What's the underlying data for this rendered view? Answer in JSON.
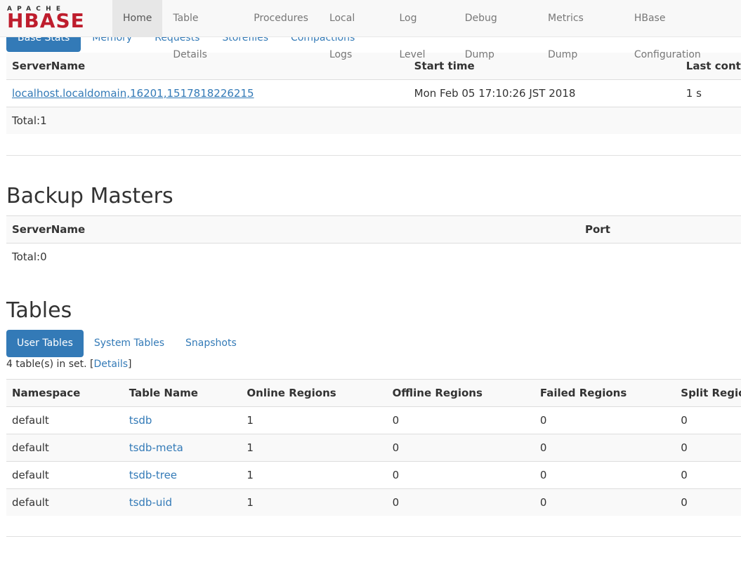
{
  "navbar": {
    "logo_top": "APACHE",
    "logo_main": "HBASE",
    "items": [
      {
        "label": "Home",
        "active": true
      },
      {
        "label": "Table Details"
      },
      {
        "label": "Procedures"
      },
      {
        "label": "Local Logs"
      },
      {
        "label": "Log Level"
      },
      {
        "label": "Debug Dump"
      },
      {
        "label": "Metrics Dump"
      },
      {
        "label": "HBase Configuration"
      }
    ]
  },
  "region_servers": {
    "tabs": [
      "Base Stats",
      "Memory",
      "Requests",
      "Storefiles",
      "Compactions"
    ],
    "columns": [
      "ServerName",
      "Start time",
      "Last contact"
    ],
    "rows": [
      {
        "server": "localhost.localdomain,16201,1517818226215",
        "start": "Mon Feb 05 17:10:26 JST 2018",
        "last": "1 s"
      }
    ],
    "total": "Total:1"
  },
  "backup_masters": {
    "title": "Backup Masters",
    "columns": [
      "ServerName",
      "Port"
    ],
    "total": "Total:0"
  },
  "tables": {
    "title": "Tables",
    "tabs": [
      "User Tables",
      "System Tables",
      "Snapshots"
    ],
    "set_info_prefix": "4 table(s) in set. [",
    "details_link": "Details",
    "set_info_suffix": "]",
    "columns": [
      "Namespace",
      "Table Name",
      "Online Regions",
      "Offline Regions",
      "Failed Regions",
      "Split Regions"
    ],
    "rows": [
      {
        "ns": "default",
        "name": "tsdb",
        "online": "1",
        "offline": "0",
        "failed": "0",
        "split": "0"
      },
      {
        "ns": "default",
        "name": "tsdb-meta",
        "online": "1",
        "offline": "0",
        "failed": "0",
        "split": "0"
      },
      {
        "ns": "default",
        "name": "tsdb-tree",
        "online": "1",
        "offline": "0",
        "failed": "0",
        "split": "0"
      },
      {
        "ns": "default",
        "name": "tsdb-uid",
        "online": "1",
        "offline": "0",
        "failed": "0",
        "split": "0"
      }
    ]
  }
}
